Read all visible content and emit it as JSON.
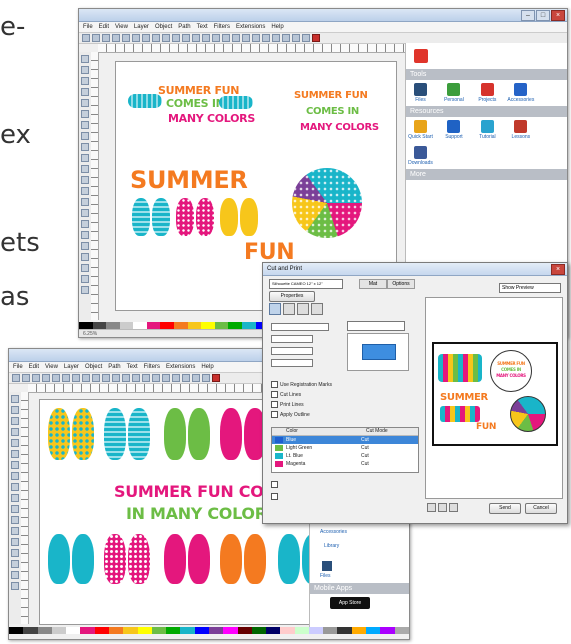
{
  "background_text": {
    "lines": [
      "e-",
      "",
      "ex",
      "",
      "ets",
      "as"
    ]
  },
  "inkscape_menu": [
    "File",
    "Edit",
    "View",
    "Layer",
    "Object",
    "Path",
    "Text",
    "Filters",
    "Extensions",
    "Help"
  ],
  "window1": {
    "artwork": {
      "line1": "SUMMER FUN",
      "line2": "COMES IN",
      "line3": "MANY COLORS",
      "big1": "SUMMER",
      "big2": "FUN",
      "right1": "SUMMER FUN",
      "right2": "COMES IN",
      "right3": "MANY COLORS"
    },
    "sidebar": {
      "tools_header": "Tools",
      "tools": [
        "Files",
        "Personal",
        "Projects",
        "Accessories",
        "Accessory"
      ],
      "resources_header": "Resources",
      "resources": [
        "Quick Start",
        "Support",
        "Tutorial",
        "Lessons",
        "Downloads"
      ],
      "more_header": "More"
    },
    "status_zoom": "6.25%"
  },
  "window2": {
    "artwork": {
      "line1": "SUMMER FUN COMES",
      "line2": "IN MANY COLORS"
    },
    "sidebar": {
      "items": [
        "Accessories",
        "Library",
        "Files"
      ],
      "footer_header": "Mobile Apps",
      "badge": "App Store"
    }
  },
  "dialog": {
    "title": "Cut and Print",
    "device_label": "Silhouette CAMEO 12\" x 12\"",
    "tab1": "Properties",
    "tab2": "Mat",
    "tab3": "Options",
    "send_label": "Send",
    "cancel_label": "Cancel",
    "preview_select": "Show Preview",
    "options": [
      "Use Registration Marks",
      "Cut Lines",
      "Print Lines",
      "Apply Outline"
    ],
    "table_header": [
      "Color",
      "Cut Mode"
    ],
    "table_rows": [
      {
        "name": "Blue",
        "mode": "Cut"
      },
      {
        "name": "Light Green",
        "mode": "Cut"
      },
      {
        "name": "Lt. Blue",
        "mode": "Cut"
      },
      {
        "name": "Magenta",
        "mode": "Cut"
      }
    ],
    "preview": {
      "line1": "SUMMER FUN",
      "line2": "COMES IN",
      "line3": "MANY COLORS",
      "big1": "SUMMER",
      "big2": "FUN"
    }
  },
  "colors": {
    "teal": "#19b5c9",
    "magenta": "#e4177d",
    "yellow": "#f7c61b",
    "green": "#6cbd45",
    "orange": "#f47a20",
    "purple": "#7b3f98"
  }
}
